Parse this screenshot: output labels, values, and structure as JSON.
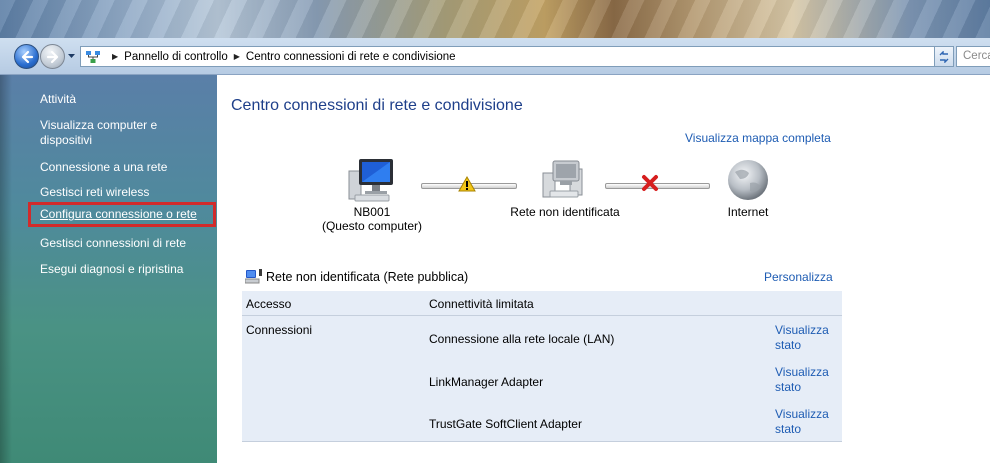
{
  "address_bar": {
    "breadcrumbs": [
      "Pannello di controllo",
      "Centro connessioni di rete e condivisione"
    ],
    "search_placeholder": "Cerca"
  },
  "sidebar": {
    "title": "Attività",
    "items": [
      {
        "label": "Visualizza computer e dispositivi"
      },
      {
        "label": "Connessione a una rete"
      },
      {
        "label": "Gestisci reti wireless"
      },
      {
        "label": "Configura connessione o rete",
        "highlighted": true
      },
      {
        "label": "Gestisci connessioni di rete"
      },
      {
        "label": "Esegui diagnosi e ripristina"
      }
    ]
  },
  "main": {
    "title": "Centro connessioni di rete e condivisione",
    "map_link": "Visualizza mappa completa",
    "network_map": {
      "computer_name": "NB001",
      "computer_sub": "(Questo computer)",
      "network_label": "Rete non identificata",
      "internet_label": "Internet",
      "link1_status": "warning",
      "link2_status": "error"
    },
    "network": {
      "name": "Rete non identificata (Rete pubblica)",
      "customize_link": "Personalizza",
      "access_label": "Accesso",
      "access_value": "Connettività limitata",
      "connections_label": "Connessioni",
      "connections": [
        {
          "name": "Connessione alla rete locale (LAN)",
          "link": "Visualizza stato",
          "link_line1": "Visualizza",
          "link_line2": "stato"
        },
        {
          "name": "LinkManager Adapter",
          "link": "Visualizza stato",
          "link_line1": "Visualizza",
          "link_line2": "stato"
        },
        {
          "name": "TrustGate SoftClient Adapter",
          "link": "Visualizza stato",
          "link_line1": "Visualizza",
          "link_line2": "stato"
        }
      ]
    }
  },
  "colors": {
    "link": "#1e5cb3",
    "title": "#1e3f8a",
    "highlight_box": "#d12b2b",
    "panel_bg": "#e6edf7"
  }
}
